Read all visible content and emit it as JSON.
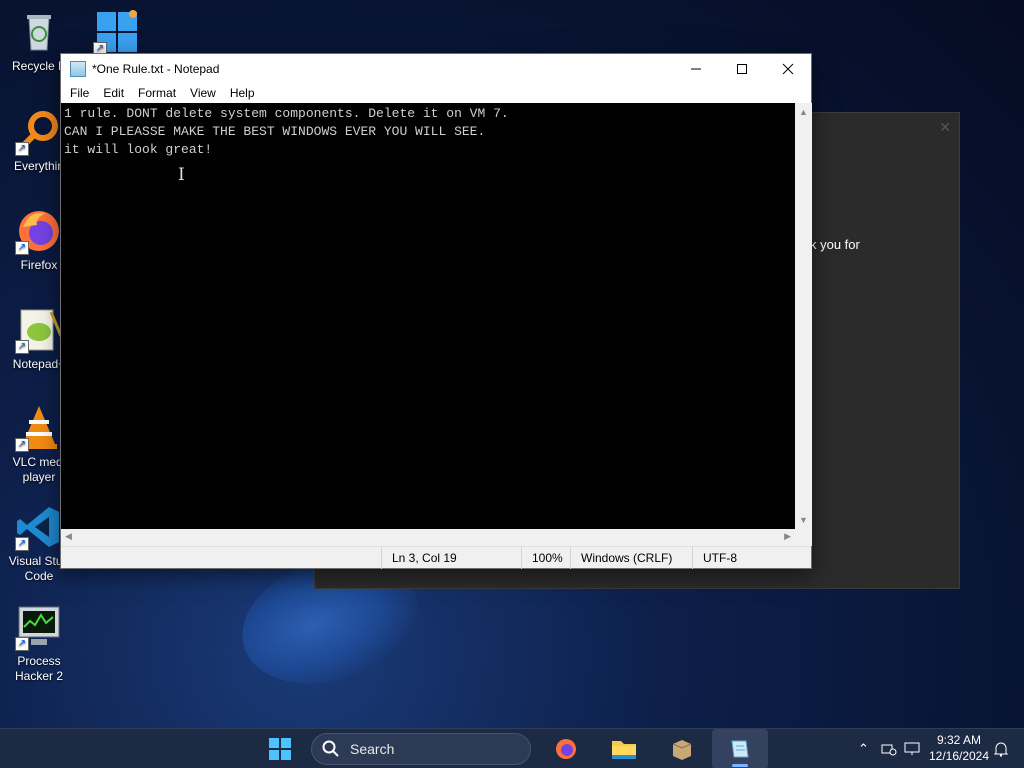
{
  "desktop": {
    "icons": [
      {
        "label": "Recycle B",
        "icon": "recycle-bin-icon"
      },
      {
        "label": "",
        "icon": "windows-logo-icon"
      },
      {
        "label": "Everythin",
        "icon": "everything-search-icon"
      },
      {
        "label": "Firefox",
        "icon": "firefox-icon"
      },
      {
        "label": "Notepad+",
        "icon": "notepad-plus-plus-icon"
      },
      {
        "label": "VLC medi player",
        "icon": "vlc-icon"
      },
      {
        "label": "Visual Stud Code",
        "icon": "vscode-icon"
      },
      {
        "label": "Process Hacker 2",
        "icon": "process-hacker-icon"
      }
    ]
  },
  "bg_dialog": {
    "partial_text": "k you for"
  },
  "notepad": {
    "title": "*One Rule.txt - Notepad",
    "menu": [
      "File",
      "Edit",
      "Format",
      "View",
      "Help"
    ],
    "content": "1 rule. DONT delete system components. Delete it on VM 7.\nCAN I PLEASSE MAKE THE BEST WINDOWS EVER YOU WILL SEE.\nit will look great!",
    "status": {
      "position": "Ln 3, Col 19",
      "zoom": "100%",
      "line_ending": "Windows (CRLF)",
      "encoding": "UTF-8"
    }
  },
  "taskbar": {
    "search_label": "Search",
    "time": "9:32 AM",
    "date": "12/16/2024"
  },
  "colors": {
    "taskbar_bg": "#1c2a44",
    "accent": "#7ab3ff"
  }
}
